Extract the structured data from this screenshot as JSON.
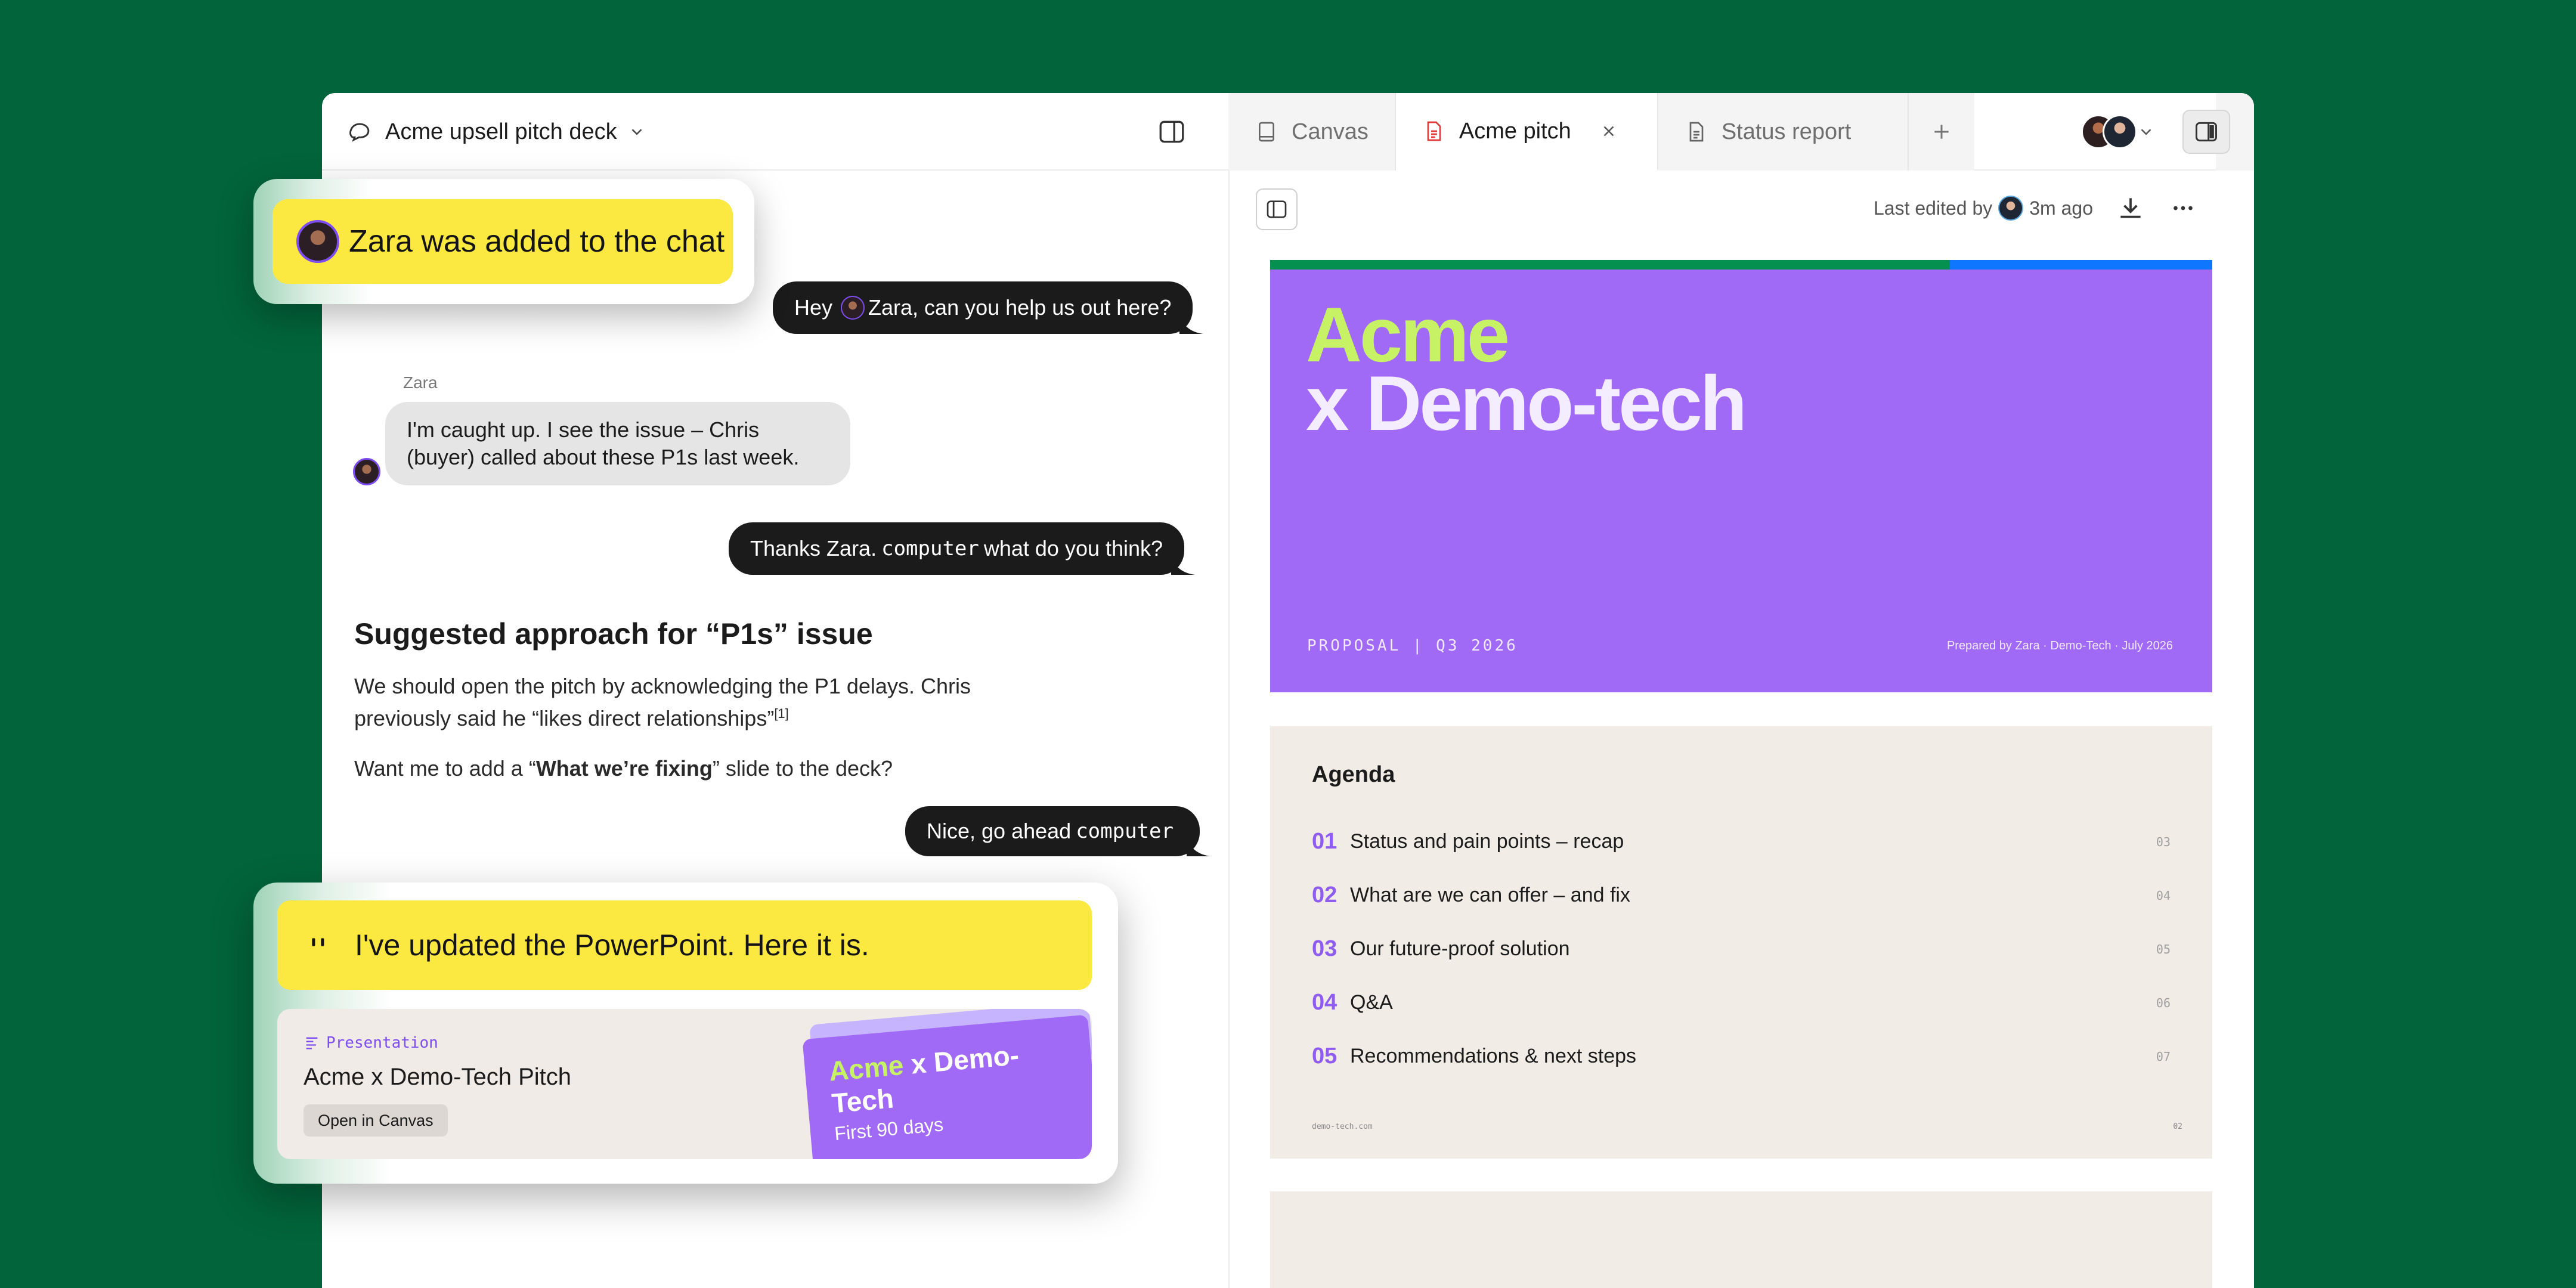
{
  "header": {
    "chat_title": "Acme upsell pitch deck",
    "tabs": [
      {
        "label": "Canvas"
      },
      {
        "label": "Acme pitch"
      },
      {
        "label": "Status report"
      }
    ]
  },
  "notification": {
    "added": "Zara was added to the chat"
  },
  "chat": {
    "msg1_pre": "Hey",
    "msg1_post": "Zara, can you help us out here?",
    "zara_sender": "Zara",
    "zara_reply": "I'm caught up. I see the issue – Chris (buyer) called about these P1s last week.",
    "msg2_pre": "Thanks Zara.",
    "msg2_token": "computer",
    "msg2_post": "what do you think?",
    "suggest_title": "Suggested approach for “P1s” issue",
    "suggest_body": "We should open the pitch by acknowledging the P1 delays. Chris previously said he “likes direct relationships”",
    "suggest_ref": "[1]",
    "ask_pre": "Want me to add a “",
    "ask_bold": "What we’re fixing",
    "ask_post": "” slide to the deck?",
    "msg3_pre": "Nice, go ahead",
    "msg3_token": "computer"
  },
  "update_card": {
    "quote": "I've updated the PowerPoint. Here it is.",
    "type_label": "Presentation",
    "title": "Acme x Demo-Tech Pitch",
    "open_button": "Open in Canvas",
    "thumb_acme": "Acme",
    "thumb_rest": "x Demo-Tech",
    "thumb_sub": "First 90 days"
  },
  "canvas": {
    "last_edited_label": "Last edited by",
    "last_edited_time": "3m ago"
  },
  "slide1": {
    "title_line1": "Acme",
    "title_line2": "x Demo-tech",
    "proposal": "PROPOSAL | Q3 2026",
    "prepared_by": "Prepared by Zara · Demo-Tech · July 2026"
  },
  "slide2": {
    "title": "Agenda",
    "items": [
      {
        "num": "01",
        "label": "Status and pain points – recap",
        "page": "03"
      },
      {
        "num": "02",
        "label": "What are we can offer – and fix",
        "page": "04"
      },
      {
        "num": "03",
        "label": "Our future-proof solution",
        "page": "05"
      },
      {
        "num": "04",
        "label": "Q&A",
        "page": "06"
      },
      {
        "num": "05",
        "label": "Recommendations & next steps",
        "page": "07"
      }
    ],
    "footer_left": "demo-tech.com",
    "footer_right": "02"
  },
  "colors": {
    "background": "#02643a",
    "highlight_yellow": "#fbe841",
    "slide_purple": "#a06af7",
    "lime": "#c7f265",
    "agenda_number": "#8e5cf0"
  }
}
